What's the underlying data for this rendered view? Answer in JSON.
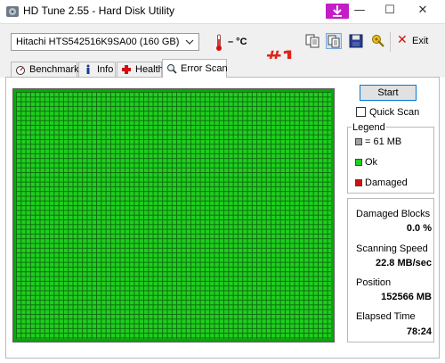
{
  "window": {
    "title": "HD Tune 2.55 - Hard Disk Utility",
    "minimize": "—",
    "maximize": "☐",
    "close": "✕"
  },
  "toolbar": {
    "drive": "Hitachi HTS542516K9SA00 (160 GB)",
    "temperature": "– °C",
    "exit_label": "Exit",
    "icons": [
      "copy-icon",
      "copy-all-icon",
      "save-icon",
      "options-icon"
    ]
  },
  "annotation": "#1",
  "tabs": [
    {
      "label": "Benchmark",
      "icon": "benchmark-icon"
    },
    {
      "label": "Info",
      "icon": "info-icon"
    },
    {
      "label": "Health",
      "icon": "health-icon"
    },
    {
      "label": "Error Scan",
      "icon": "error-scan-icon",
      "active": true
    }
  ],
  "scan": {
    "start_label": "Start",
    "quick_scan_label": "Quick Scan",
    "quick_scan_checked": false
  },
  "legend": {
    "title": "Legend",
    "items": [
      {
        "label": "= 61 MB",
        "color": "#a0a0a0"
      },
      {
        "label": "Ok",
        "color": "#1fce1f"
      },
      {
        "label": "Damaged",
        "color": "#d01010"
      }
    ]
  },
  "stats": {
    "damaged_blocks_label": "Damaged Blocks",
    "damaged_blocks_value": "0.0 %",
    "scanning_speed_label": "Scanning Speed",
    "scanning_speed_value": "22.8 MB/sec",
    "position_label": "Position",
    "position_value": "152566 MB",
    "elapsed_time_label": "Elapsed Time",
    "elapsed_time_value": "78:24"
  },
  "colors": {
    "ok_block": "#1fce1f",
    "accent": "#0078d7",
    "annotation": "#e0241b"
  }
}
